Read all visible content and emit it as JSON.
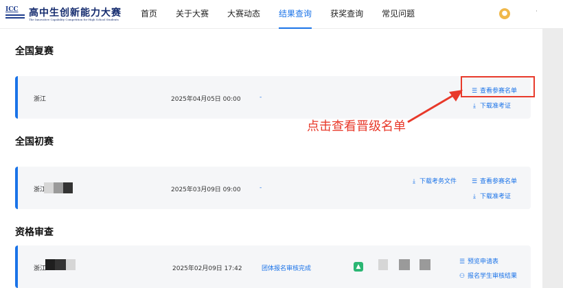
{
  "logo": {
    "abbr": "ICC",
    "title_cn": "高中生创新能力大赛",
    "title_en": "The Innovative Capability Competition for High School Students"
  },
  "nav": {
    "items": [
      "首页",
      "关于大赛",
      "大赛动态",
      "结果查询",
      "获奖查询",
      "常见问题"
    ],
    "active": "结果查询"
  },
  "user": {
    "avatar_glyph": "●",
    "name": "·"
  },
  "sections": [
    {
      "title": "全国复赛",
      "card": {
        "region": "浙江",
        "date": "2025年04月05日 00:00",
        "status": "-",
        "links": [
          "查看参赛名单",
          "下载准考证"
        ]
      }
    },
    {
      "title": "全国初赛",
      "card": {
        "region": "浙江",
        "date": "2025年03月09日 09:00",
        "status": "-",
        "links": [
          "下载考务文件",
          "查看参赛名单",
          "下载准考证"
        ]
      }
    },
    {
      "title": "资格审查",
      "card": {
        "region": "浙江",
        "date": "2025年02月09日 17:42",
        "status": "团体报名审核完成",
        "links": [
          "预览申请表",
          "报名学生审核结果"
        ]
      }
    }
  ],
  "annotation": {
    "text": "点击查看晋级名单",
    "color": "#e8392a"
  },
  "colors": {
    "accent": "#1a73e8",
    "annotation_red": "#e8392a"
  },
  "icons": {
    "list": "list-icon",
    "download": "download-icon",
    "users": "users-icon",
    "image": "image-icon"
  }
}
